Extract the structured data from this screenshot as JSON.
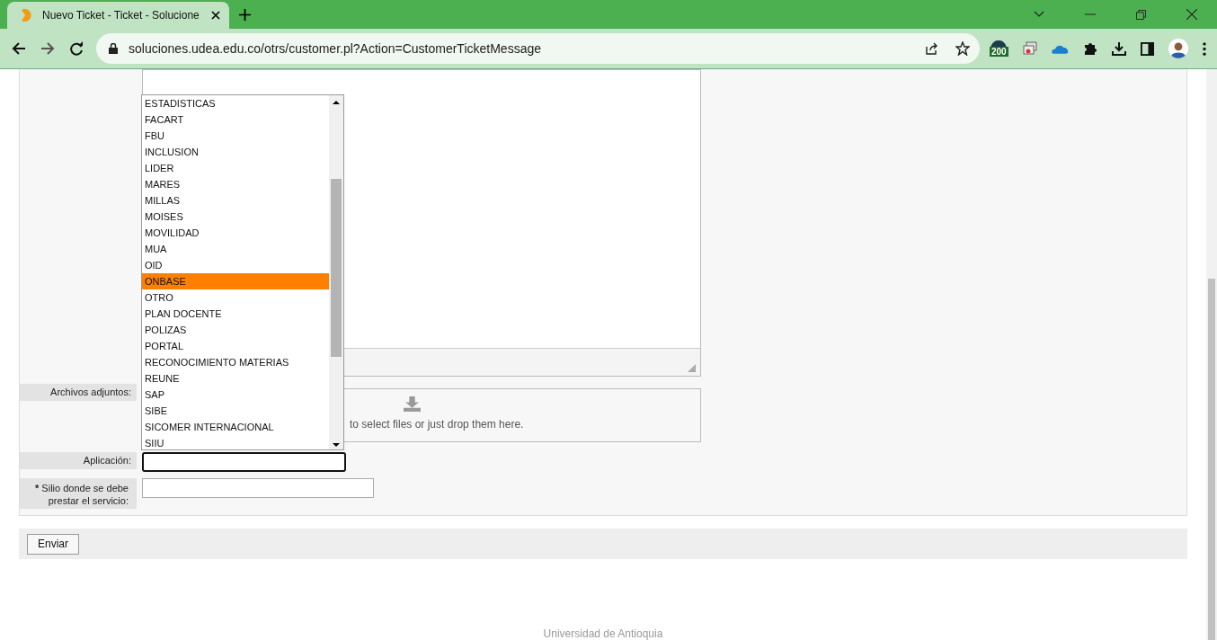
{
  "browser": {
    "tab": {
      "title": "Nuevo Ticket - Ticket - Solucione",
      "selected": true
    },
    "url": "soluciones.udea.edu.co/otrs/customer.pl?Action=CustomerTicketMessage",
    "extension_badge": "200"
  },
  "form": {
    "attachments": {
      "label": "Archivos adjuntos:",
      "dropzone_text": "to select files or just drop them here."
    },
    "application": {
      "label": "Aplicación:",
      "focused": true,
      "options": [
        {
          "label": "ESTADISTICAS",
          "selected": false
        },
        {
          "label": "FACART",
          "selected": false
        },
        {
          "label": "FBU",
          "selected": false
        },
        {
          "label": "INCLUSION",
          "selected": false
        },
        {
          "label": "LIDER",
          "selected": false
        },
        {
          "label": "MARES",
          "selected": false
        },
        {
          "label": "MILLAS",
          "selected": false
        },
        {
          "label": "MOISES",
          "selected": false
        },
        {
          "label": "MOVILIDAD",
          "selected": false
        },
        {
          "label": "MUA",
          "selected": false
        },
        {
          "label": "OID",
          "selected": false
        },
        {
          "label": "ONBASE",
          "selected": true
        },
        {
          "label": "OTRO",
          "selected": false
        },
        {
          "label": "PLAN DOCENTE",
          "selected": false
        },
        {
          "label": "POLIZAS",
          "selected": false
        },
        {
          "label": "PORTAL",
          "selected": false
        },
        {
          "label": "RECONOCIMIENTO MATERIAS",
          "selected": false
        },
        {
          "label": "REUNE",
          "selected": false
        },
        {
          "label": "SAP",
          "selected": false
        },
        {
          "label": "SIBE",
          "selected": false
        },
        {
          "label": "SICOMER INTERNACIONAL",
          "selected": false
        },
        {
          "label": "SIIU",
          "selected": false
        }
      ]
    },
    "site": {
      "required_mark": "*",
      "label": "Silio donde se debe prestar el servicio:"
    }
  },
  "buttons": [
    "Enviar"
  ],
  "footer": "Universidad de Antioquia"
}
